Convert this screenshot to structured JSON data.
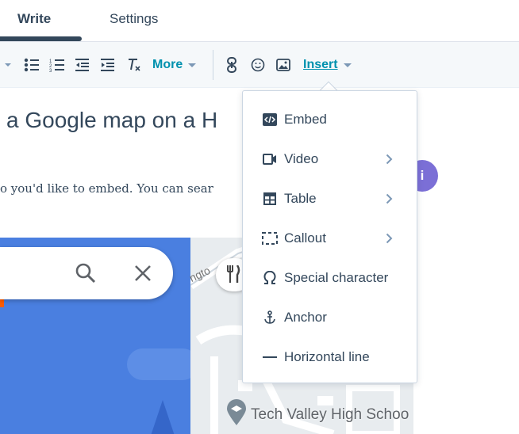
{
  "tabs": {
    "write": "Write",
    "settings": "Settings"
  },
  "toolbar": {
    "more_label": "More",
    "insert_label": "Insert",
    "icons": [
      "chevron-down-icon",
      "bulleted-list-icon",
      "numbered-list-icon",
      "outdent-icon",
      "indent-icon",
      "clear-format-icon",
      "link-icon",
      "emoji-icon",
      "image-icon"
    ]
  },
  "editor": {
    "heading": "a Google map on a H",
    "paragraph": "o you'd like to embed. You can sear",
    "avatar_letter": "i"
  },
  "map": {
    "poi_label": "Tech Valley High Schoo",
    "road_label": "ngto"
  },
  "insert_menu": {
    "items": [
      {
        "label": "Embed",
        "icon": "embed-icon",
        "submenu": false
      },
      {
        "label": "Video",
        "icon": "video-icon",
        "submenu": true
      },
      {
        "label": "Table",
        "icon": "table-icon",
        "submenu": true
      },
      {
        "label": "Callout",
        "icon": "callout-icon",
        "submenu": true
      },
      {
        "label": "Special character",
        "icon": "omega-icon",
        "submenu": false
      },
      {
        "label": "Anchor",
        "icon": "anchor-icon",
        "submenu": false
      },
      {
        "label": "Horizontal line",
        "icon": "horizontal-line-icon",
        "submenu": false
      }
    ]
  },
  "colors": {
    "accent": "#0091ae",
    "text": "#33475b",
    "avatar": "#7b6fd6",
    "map_blue": "#4a7fe0",
    "search_accent": "#ff5c00"
  }
}
